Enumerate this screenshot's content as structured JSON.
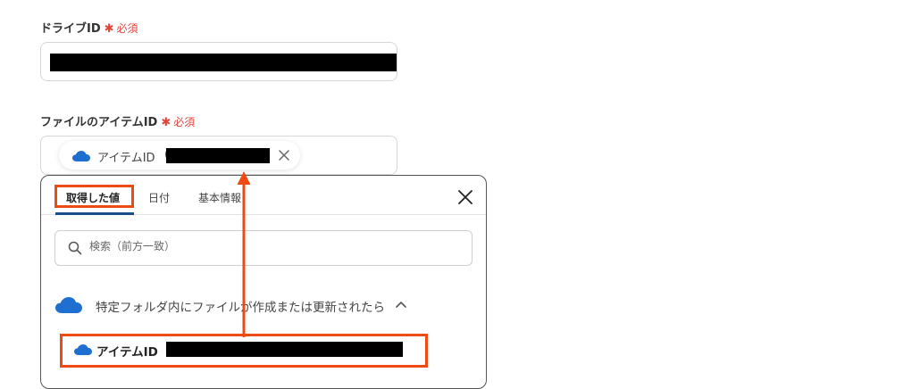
{
  "drive_field": {
    "label": "ドライブID",
    "required": "必須"
  },
  "item_field": {
    "label": "ファイルのアイテムID",
    "required": "必須",
    "chip_label": "アイテムID",
    "chip_paren": "("
  },
  "panel": {
    "tabs": [
      "取得した値",
      "日付",
      "基本情報"
    ],
    "search_placeholder": "検索（前方一致）",
    "group_title": "特定フォルダ内にファイルが作成または更新されたら",
    "item_label": "アイテムID"
  },
  "colors": {
    "required": "#e0463b",
    "highlight": "#f04a14",
    "onedrive": "#1f6fd1",
    "tab_underline": "#1b4d8c"
  },
  "icons": {
    "cloud": "onedrive-cloud-icon",
    "close": "close-icon",
    "search": "search-icon",
    "chevron": "chevron-up-icon"
  }
}
